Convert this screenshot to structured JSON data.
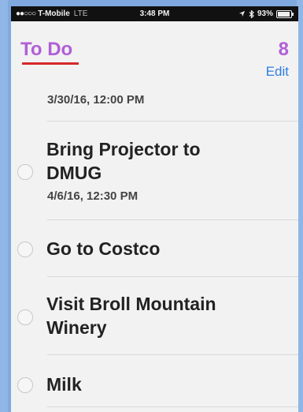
{
  "status_bar": {
    "signal_dots": "●●○○○",
    "carrier": "T-Mobile",
    "network": "LTE",
    "time": "3:48 PM",
    "location_icon": "location-arrow-icon",
    "bluetooth_icon": "bluetooth-icon",
    "battery": "93%",
    "battery_level": 0.93
  },
  "header": {
    "list_title": "To Do",
    "count": "8",
    "edit_label": "Edit",
    "title_color": "#b05fd6",
    "edit_color": "#2f7de1"
  },
  "items": [
    {
      "title": "",
      "date": "3/30/16, 12:00 PM"
    },
    {
      "title": "Bring Projector to DMUG",
      "date": "4/6/16, 12:30 PM"
    },
    {
      "title": "Go to Costco",
      "date": ""
    },
    {
      "title": "Visit Broll Mountain Winery",
      "date": ""
    },
    {
      "title": "Milk",
      "date": ""
    }
  ]
}
